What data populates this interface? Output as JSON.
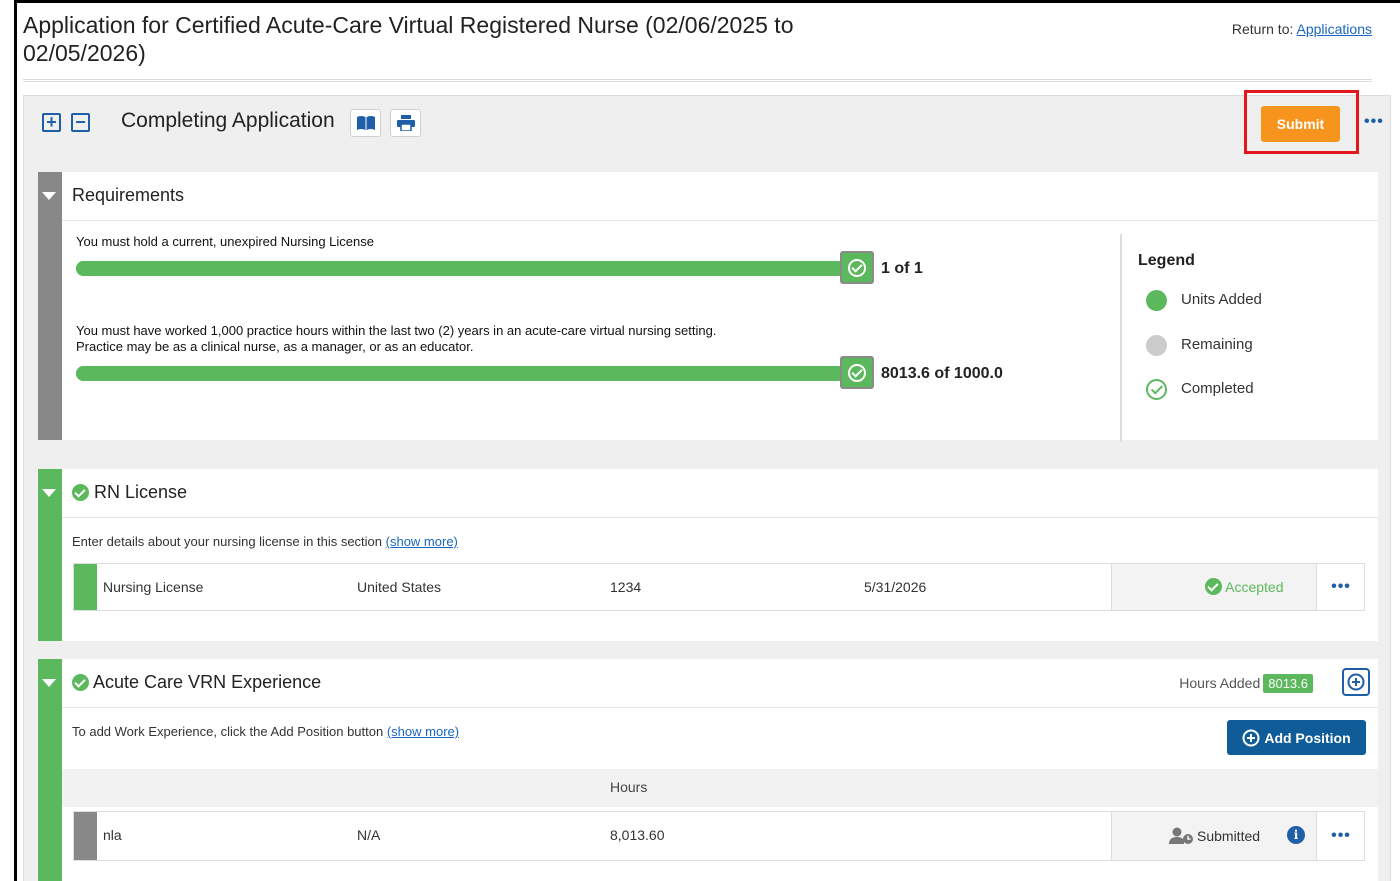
{
  "page": {
    "title": "Application for Certified Acute-Care Virtual Registered Nurse (02/06/2025 to 02/05/2026)",
    "return_to_label": "Return to:",
    "return_to_link": "Applications"
  },
  "toolbar": {
    "expand_icon": "plus-square-icon",
    "collapse_icon": "minus-square-icon",
    "title": "Completing Application",
    "book_icon": "book-icon",
    "print_icon": "print-icon",
    "submit_label": "Submit",
    "more_label": "•••"
  },
  "requirements": {
    "title": "Requirements",
    "items": [
      {
        "text": "You must hold a current, unexpired Nursing License",
        "progress_percent": 100,
        "count": "1 of 1"
      },
      {
        "text": "You must have worked 1,000 practice hours within the last two (2) years in an acute-care virtual nursing setting.\nPractice may be as a clinical nurse, as a manager, or as an educator.",
        "progress_percent": 100,
        "count": "8013.6 of 1000.0"
      }
    ],
    "legend": {
      "title": "Legend",
      "items": [
        {
          "label": "Units Added",
          "color": "#5cb85c"
        },
        {
          "label": "Remaining",
          "color": "#cccccc"
        },
        {
          "label": "Completed",
          "color": "#5cb85c"
        }
      ]
    }
  },
  "rn_license": {
    "title": "RN License",
    "description": "Enter details about your nursing license in this section",
    "show_more": "(show more)",
    "rows": [
      {
        "type": "Nursing License",
        "country": "United States",
        "number": "1234",
        "expiration": "5/31/2026",
        "status": "Accepted",
        "status_color": "#5cb85c"
      }
    ]
  },
  "experience": {
    "title": "Acute Care VRN Experience",
    "hours_added_label": "Hours Added",
    "hours_added_value": "8013.6",
    "description": "To add Work Experience, click the Add Position button",
    "show_more": "(show more)",
    "add_position_label": "Add Position",
    "hours_header": "Hours",
    "rows": [
      {
        "name": "nla",
        "location": "N/A",
        "hours": "8,013.60",
        "status": "Submitted"
      }
    ]
  },
  "colors": {
    "accent": "#1f5fa8",
    "success": "#5cb85c",
    "submit": "#f7941d",
    "highlight": "#e3161b"
  }
}
